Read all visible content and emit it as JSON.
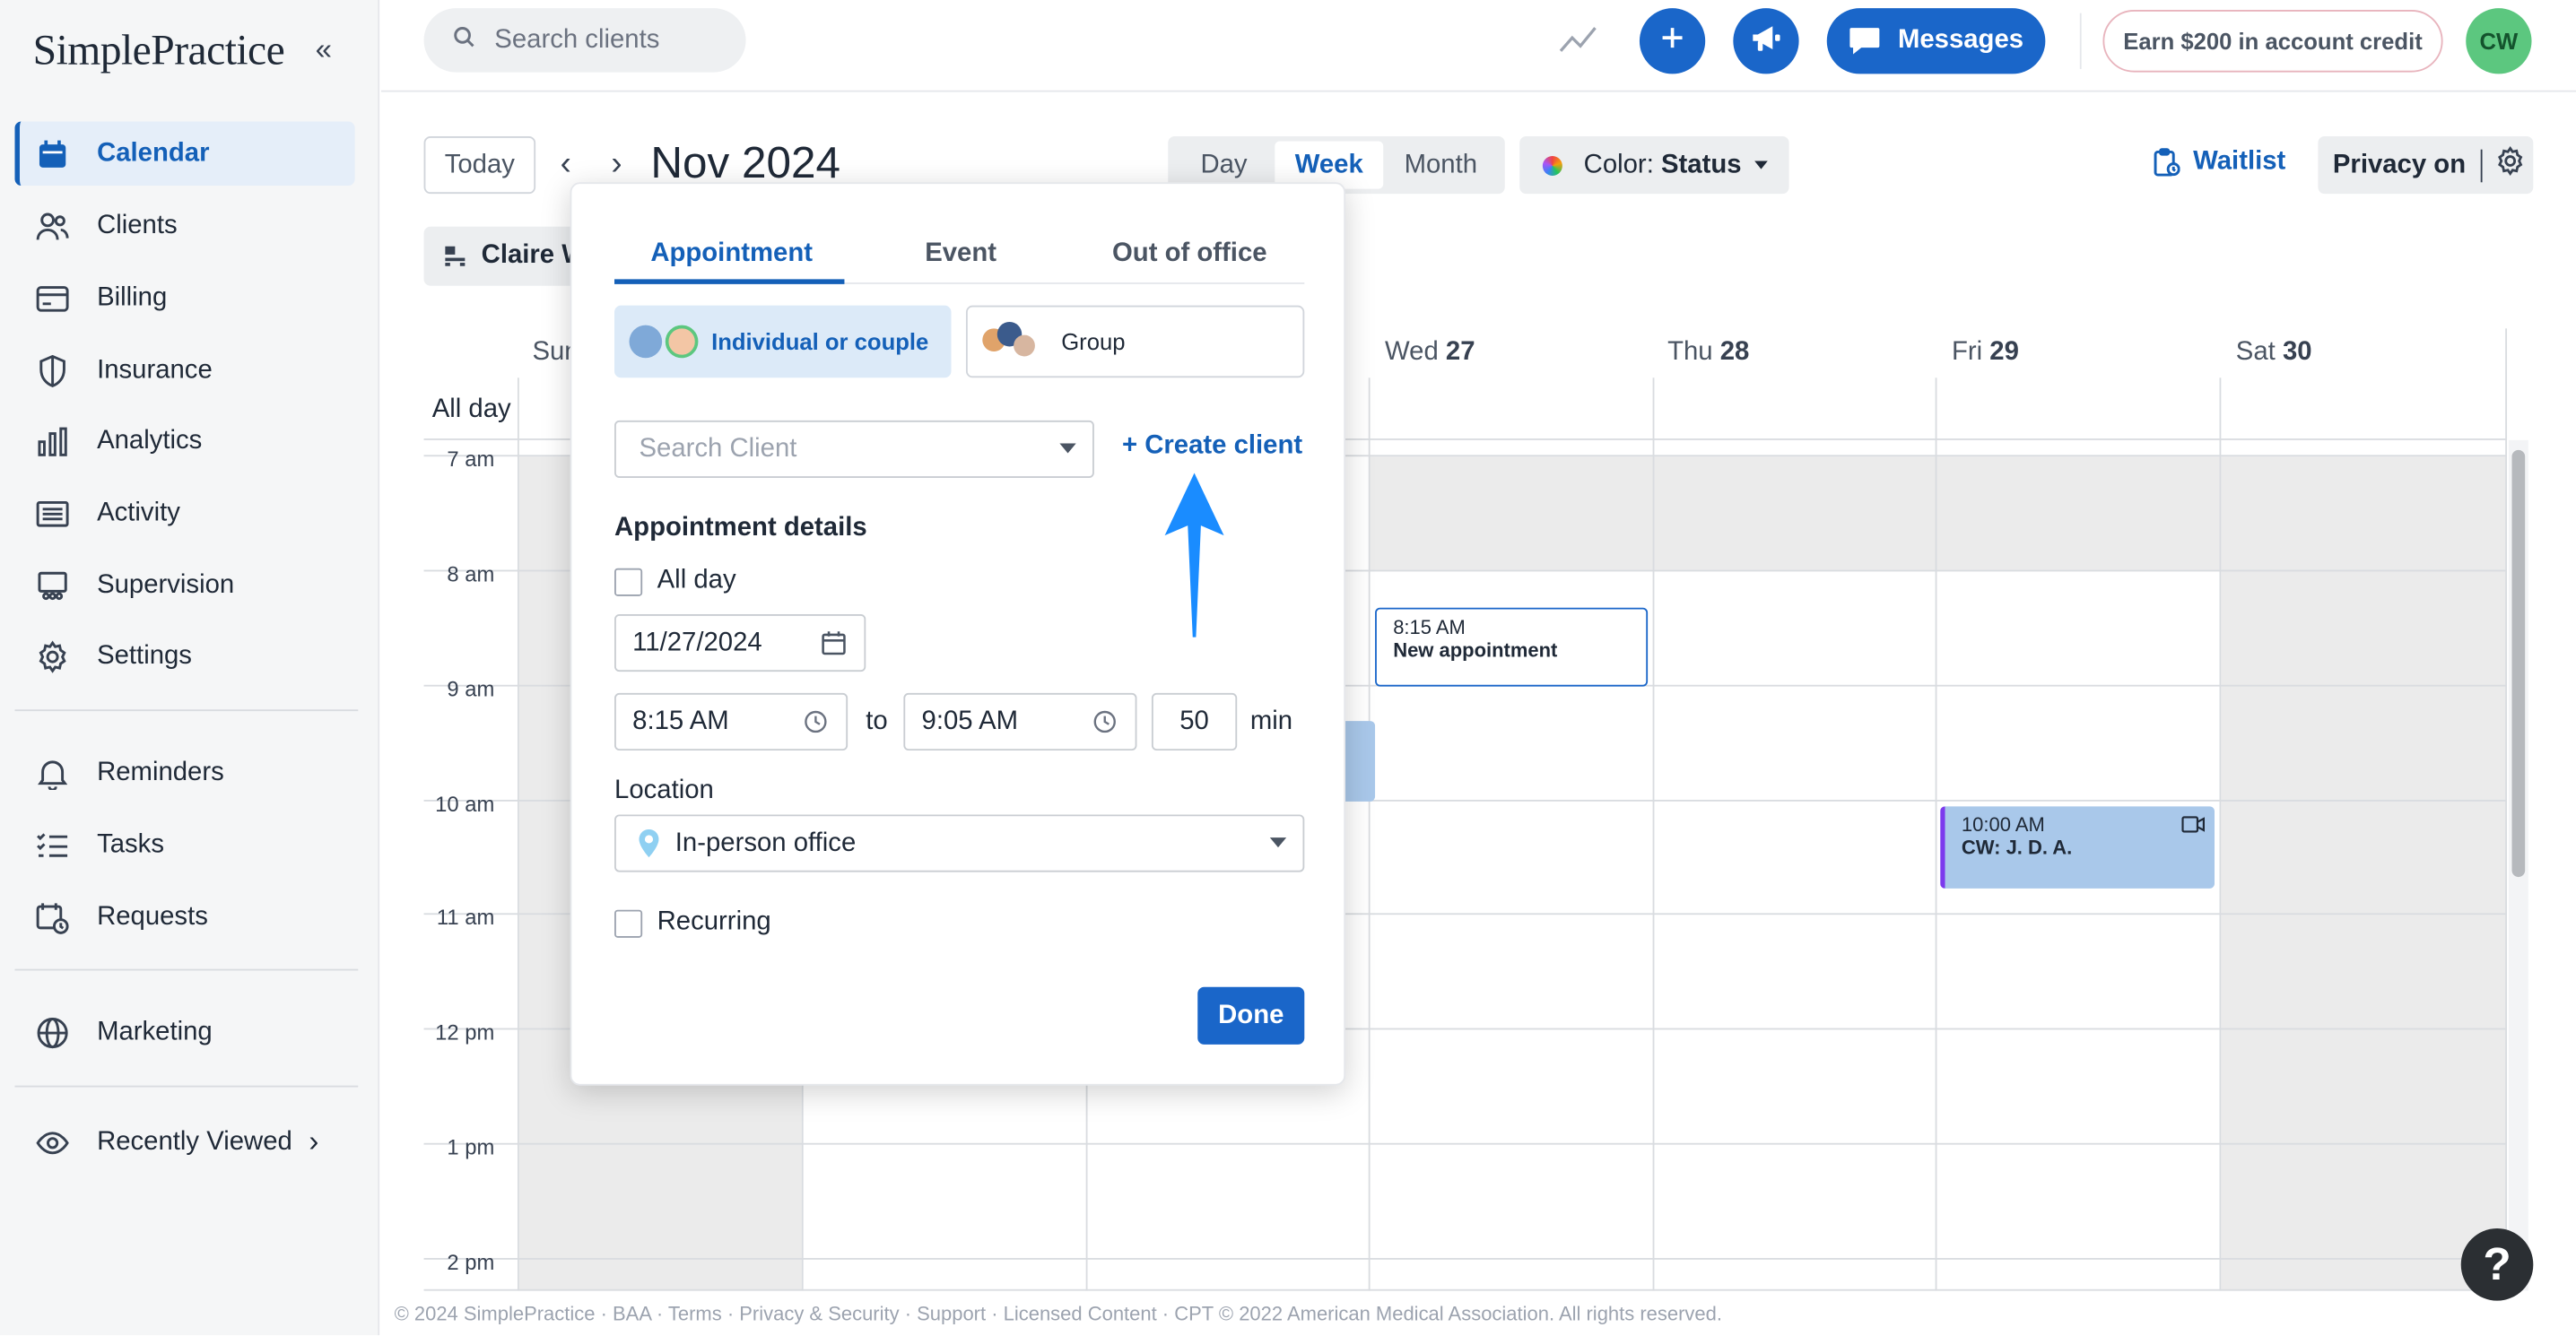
{
  "app": {
    "logo": "SimplePractice"
  },
  "sidebar": {
    "items": [
      {
        "label": "Calendar",
        "icon": "calendar-icon"
      },
      {
        "label": "Clients",
        "icon": "clients-icon"
      },
      {
        "label": "Billing",
        "icon": "billing-icon"
      },
      {
        "label": "Insurance",
        "icon": "shield-icon"
      },
      {
        "label": "Analytics",
        "icon": "analytics-icon"
      },
      {
        "label": "Activity",
        "icon": "activity-icon"
      },
      {
        "label": "Supervision",
        "icon": "supervision-icon"
      },
      {
        "label": "Settings",
        "icon": "gear-icon"
      },
      {
        "label": "Reminders",
        "icon": "bell-icon"
      },
      {
        "label": "Tasks",
        "icon": "tasks-icon"
      },
      {
        "label": "Requests",
        "icon": "requests-icon"
      },
      {
        "label": "Marketing",
        "icon": "globe-icon"
      },
      {
        "label": "Recently Viewed",
        "icon": "eye-icon"
      }
    ]
  },
  "topbar": {
    "search_placeholder": "Search clients",
    "messages_label": "Messages",
    "earn_label": "Earn $200 in account credit",
    "avatar_initials": "CW"
  },
  "toolbar": {
    "today_label": "Today",
    "month_title": "Nov 2024",
    "views": [
      "Day",
      "Week",
      "Month"
    ],
    "active_view": "Week",
    "color_label": "Color:",
    "color_value": "Status",
    "waitlist_label": "Waitlist",
    "privacy_label": "Privacy on",
    "clinician_label": "Claire W"
  },
  "calendar": {
    "days": [
      {
        "name": "Sun",
        "num": ""
      },
      {
        "name": "Wed",
        "num": "27"
      },
      {
        "name": "Thu",
        "num": "28"
      },
      {
        "name": "Fri",
        "num": "29"
      },
      {
        "name": "Sat",
        "num": "30"
      }
    ],
    "allday_label": "All day",
    "times": [
      "7 am",
      "8 am",
      "9 am",
      "10 am",
      "11 am",
      "12 pm",
      "1 pm",
      "2 pm"
    ],
    "events": [
      {
        "time": "8:15 AM",
        "title": "New appointment"
      },
      {
        "time": "10:00 AM",
        "title": "CW: J. D. A."
      }
    ]
  },
  "popover": {
    "tabs": [
      "Appointment",
      "Event",
      "Out of office"
    ],
    "active_tab": "Appointment",
    "client_types": [
      "Individual or couple",
      "Group"
    ],
    "search_client_placeholder": "Search Client",
    "create_client_label": "+ Create client",
    "details_title": "Appointment details",
    "all_day_label": "All day",
    "date_value": "11/27/2024",
    "start_time": "8:15 AM",
    "to_label": "to",
    "end_time": "9:05 AM",
    "duration": "50",
    "duration_unit": "min",
    "location_label": "Location",
    "location_value": "In-person office",
    "recurring_label": "Recurring",
    "done_label": "Done"
  },
  "footer": {
    "text": "© 2024 SimplePractice · BAA · Terms · Privacy & Security · Support · Licensed Content · CPT © 2022 American Medical Association. All rights reserved."
  },
  "help_label": "?",
  "colors": {
    "primary": "#1a66c9",
    "accent_text": "#1460b8",
    "event_fill": "#a9c8ea",
    "avatar": "#5cc77f"
  }
}
